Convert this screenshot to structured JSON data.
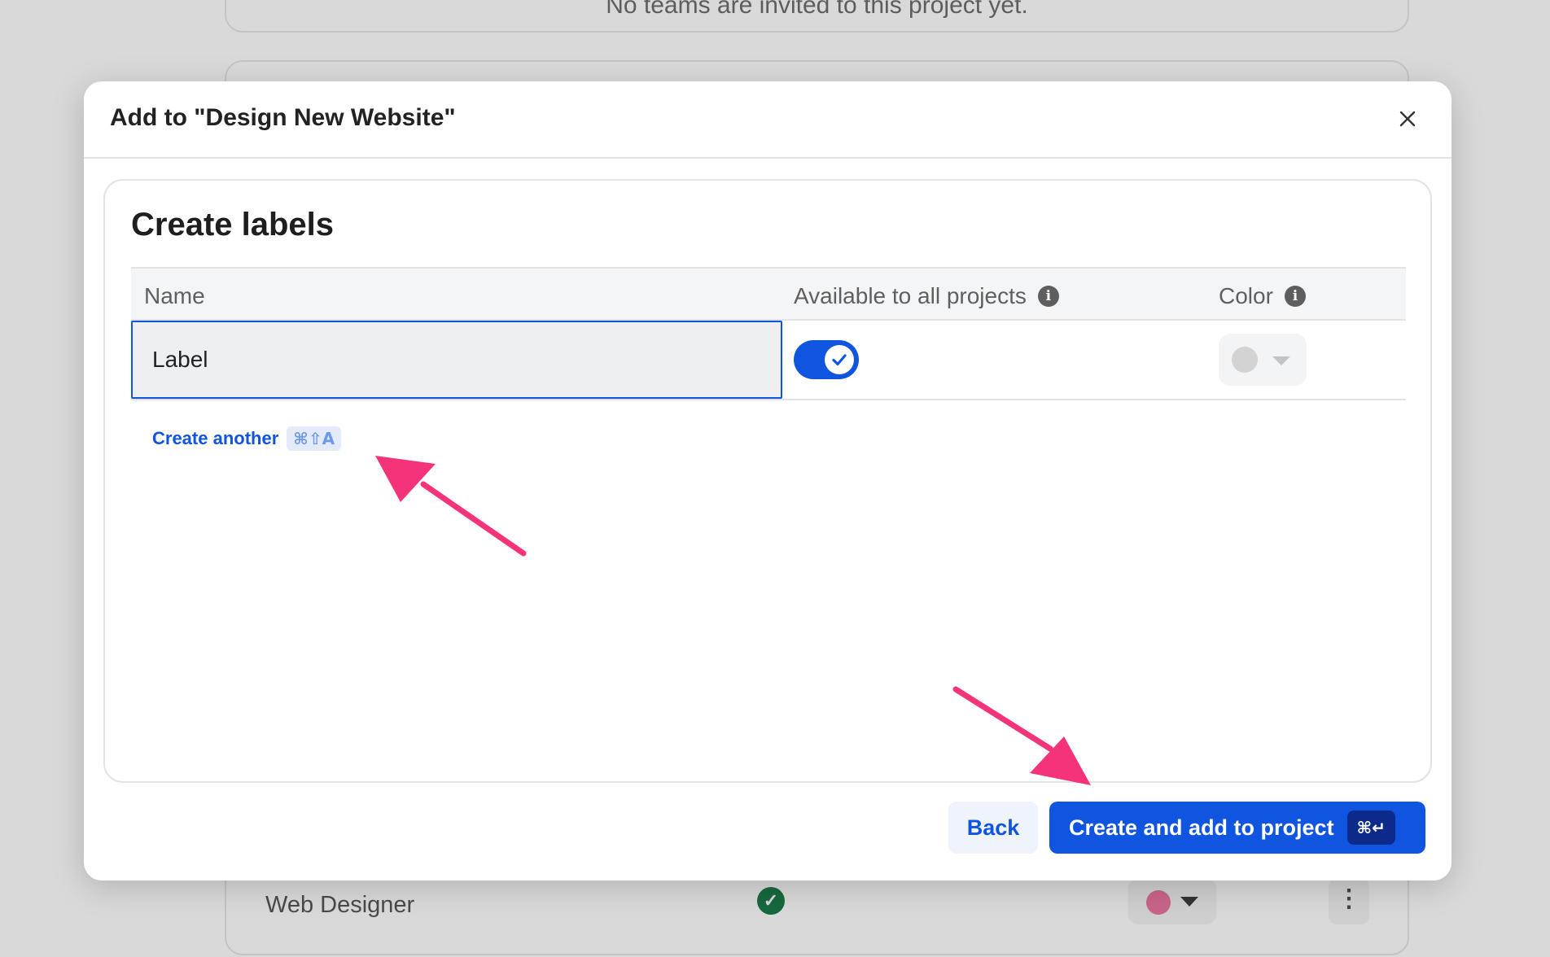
{
  "background": {
    "empty_teams_text": "No teams are invited to this project yet.",
    "row": {
      "role": "Web Designer",
      "kebab": "⋮"
    }
  },
  "modal": {
    "title": "Add to \"Design New Website\"",
    "section_title": "Create labels",
    "table": {
      "headers": {
        "name": "Name",
        "available": "Available to all projects",
        "color": "Color"
      },
      "info_glyph": "i",
      "row": {
        "name_value": "Label",
        "available_to_all": true
      }
    },
    "create_another": {
      "label": "Create another",
      "shortcut": "⌘⇧A"
    },
    "footer": {
      "back_label": "Back",
      "primary_label": "Create and add to project",
      "primary_shortcut": "⌘↵"
    }
  },
  "colors": {
    "accent": "#1055E0",
    "annotation_arrow": "#F5337A",
    "status_green": "#17683F"
  }
}
